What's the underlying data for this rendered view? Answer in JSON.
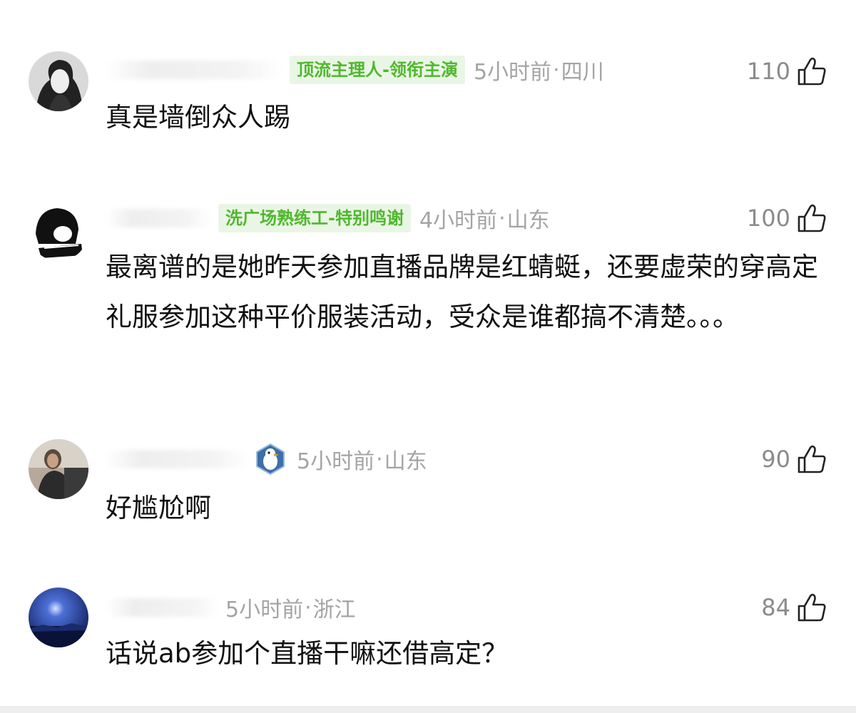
{
  "comments": [
    {
      "badge": "顶流主理人-领衔主演",
      "time": "5小时前",
      "location": "四川",
      "likes": "110",
      "text": "真是墙倒众人踢",
      "avatar": "avatar-woman-bw"
    },
    {
      "badge": "洗广场熟练工-特别鸣谢",
      "time": "4小时前",
      "location": "山东",
      "likes": "100",
      "text": "最离谱的是她昨天参加直播品牌是红蜻蜓，还要虚荣的穿高定礼服参加这种平价服装活动，受众是谁都搞不清楚。。。",
      "avatar": "avatar-cartoon-bw"
    },
    {
      "badge": "",
      "medal_icon": "penguin-medal-icon",
      "time": "5小时前",
      "location": "山东",
      "likes": "90",
      "text": "好尴尬啊",
      "avatar": "avatar-photo-person"
    },
    {
      "badge": "",
      "time": "5小时前",
      "location": "浙江",
      "likes": "84",
      "text": "话说ab参加个直播干嘛还借高定？",
      "avatar": "avatar-night-sky"
    }
  ],
  "colors": {
    "badge_text": "#4fb82e",
    "badge_bg": "#eaf6e5",
    "meta_text": "#a4a4a4",
    "like_text": "#8b8b8b",
    "body_text": "#111111"
  },
  "icons": {
    "like": "thumbs-up-outline-icon"
  }
}
